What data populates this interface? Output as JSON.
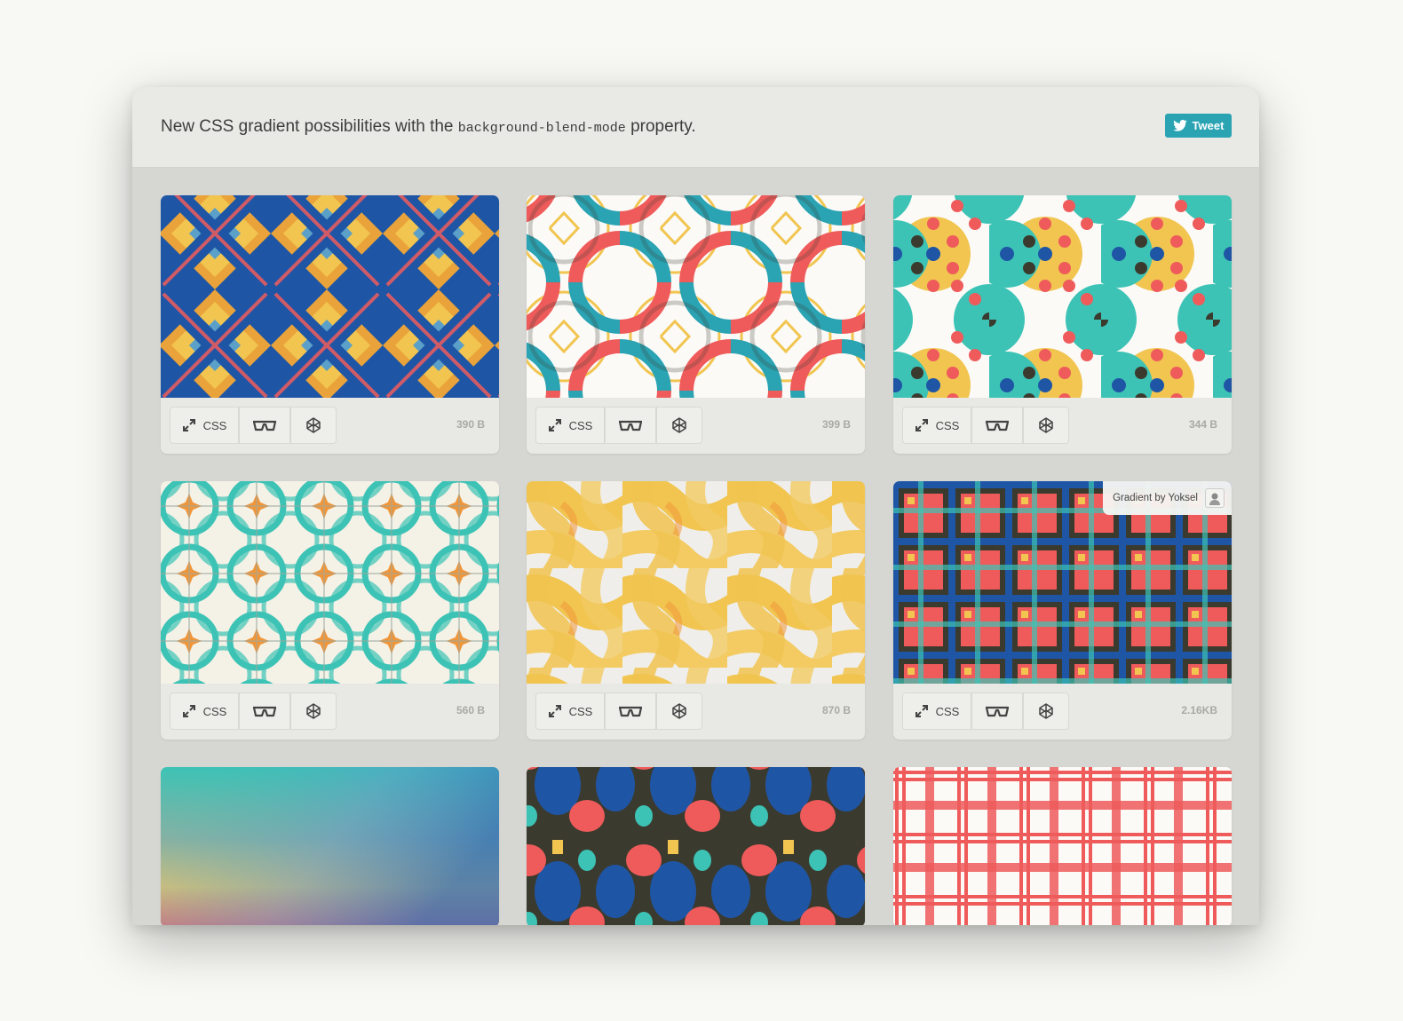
{
  "header": {
    "title_prefix": "New CSS gradient possibilities with the ",
    "title_code": "background-blend-mode",
    "title_suffix": " property.",
    "tweet_label": "Tweet"
  },
  "cards": [
    {
      "css_label": "CSS",
      "size": "390 B"
    },
    {
      "css_label": "CSS",
      "size": "399 B"
    },
    {
      "css_label": "CSS",
      "size": "344 B"
    },
    {
      "css_label": "CSS",
      "size": "560 B"
    },
    {
      "css_label": "CSS",
      "size": "870 B"
    },
    {
      "css_label": "CSS",
      "size": "2.16KB",
      "author": "Gradient by Yoksel"
    },
    {},
    {},
    {}
  ],
  "colors": {
    "accent": "#2aa3b3",
    "red": "#ef5b5b",
    "teal": "#3cc3b5",
    "yellow": "#f1c550",
    "blue": "#1f55a5",
    "dark": "#3b3a2e"
  },
  "icons": [
    "twitter-icon",
    "expand-icon",
    "glasses-icon",
    "codepen-icon"
  ]
}
